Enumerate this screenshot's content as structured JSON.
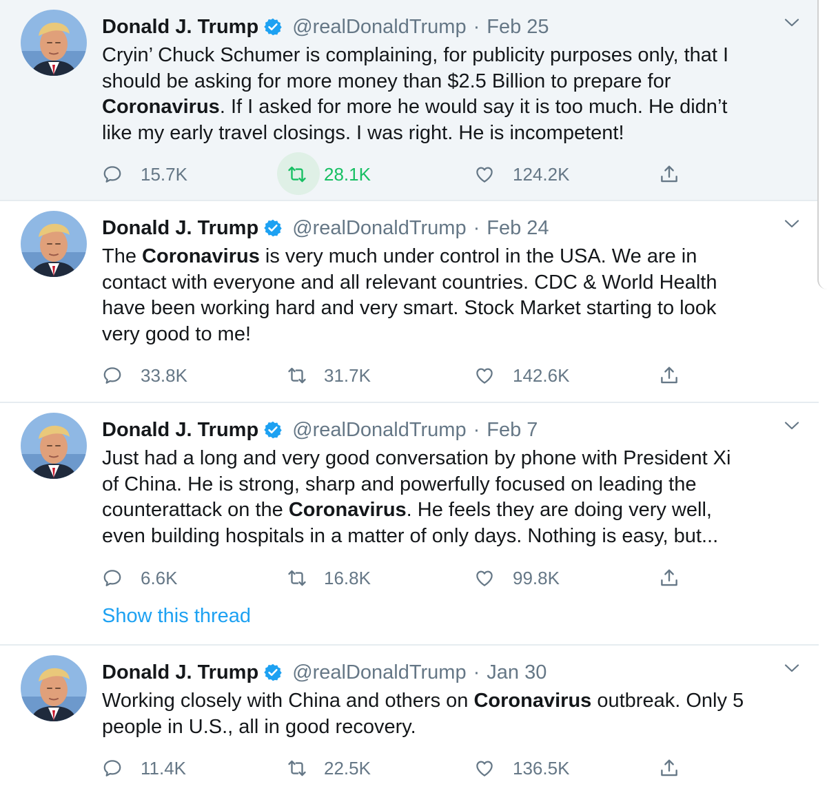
{
  "colors": {
    "name_text": "#14171a",
    "secondary_text": "#657786",
    "verified_badge": "#1da1f2",
    "retweet_active": "#17bf63",
    "link": "#1da1f2",
    "highlight_bg": "#f1f5f8"
  },
  "icons": {
    "reply": "speech-bubble-icon",
    "retweet": "retweet-arrows-icon",
    "like": "heart-icon",
    "share": "share-upload-icon",
    "verified": "verified-badge-icon",
    "caret": "chevron-down-icon"
  },
  "tweets": [
    {
      "author": "Donald J. Trump",
      "handle": "@realDonaldTrump",
      "separator": "·",
      "date": "Feb 25",
      "text": [
        "Cryin’ Chuck Schumer is complaining, for publicity purposes only, that I",
        "should be asking for more money than $2.5 Billion to prepare for",
        {
          "bold": "Coronavirus",
          "rest": ". If I asked for more he would say it is too much. He didn’t"
        },
        "like my early travel closings. I was right. He is incompetent!"
      ],
      "replies": "15.7K",
      "retweets": "28.1K",
      "likes": "124.2K",
      "retweeted": true
    },
    {
      "author": "Donald J. Trump",
      "handle": "@realDonaldTrump",
      "separator": "·",
      "date": "Feb 24",
      "text_pre": "The ",
      "text_bold": "Coronavirus",
      "text_lines": [
        " is very much under control in the USA. We are in",
        "contact with everyone and all relevant countries. CDC & World Health",
        "have been working hard and very smart. Stock Market starting to look",
        "very good to me!"
      ],
      "replies": "33.8K",
      "retweets": "31.7K",
      "likes": "142.6K",
      "retweeted": false
    },
    {
      "author": "Donald J. Trump",
      "handle": "@realDonaldTrump",
      "separator": "·",
      "date": "Feb 7",
      "text_lines": [
        "Just had a long and very good conversation by phone with President Xi",
        "of China. He is strong, sharp and powerfully focused on leading the",
        "counterattack on the ",
        "even building hospitals in a matter of only days. Nothing is easy, but..."
      ],
      "text_bold": "Coronavirus",
      "text_after_bold": ". He feels they are doing very well,",
      "replies": "6.6K",
      "retweets": "16.8K",
      "likes": "99.8K",
      "thread_link": "Show this thread",
      "retweeted": false
    },
    {
      "author": "Donald J. Trump",
      "handle": "@realDonaldTrump",
      "separator": "·",
      "date": "Jan 30",
      "text_pre": "Working closely with China and others on ",
      "text_bold": "Coronavirus",
      "text_after_bold": " outbreak. Only 5",
      "text_line2": "people in U.S., all in good recovery.",
      "replies": "11.4K",
      "retweets": "22.5K",
      "likes": "136.5K",
      "retweeted": false
    }
  ]
}
